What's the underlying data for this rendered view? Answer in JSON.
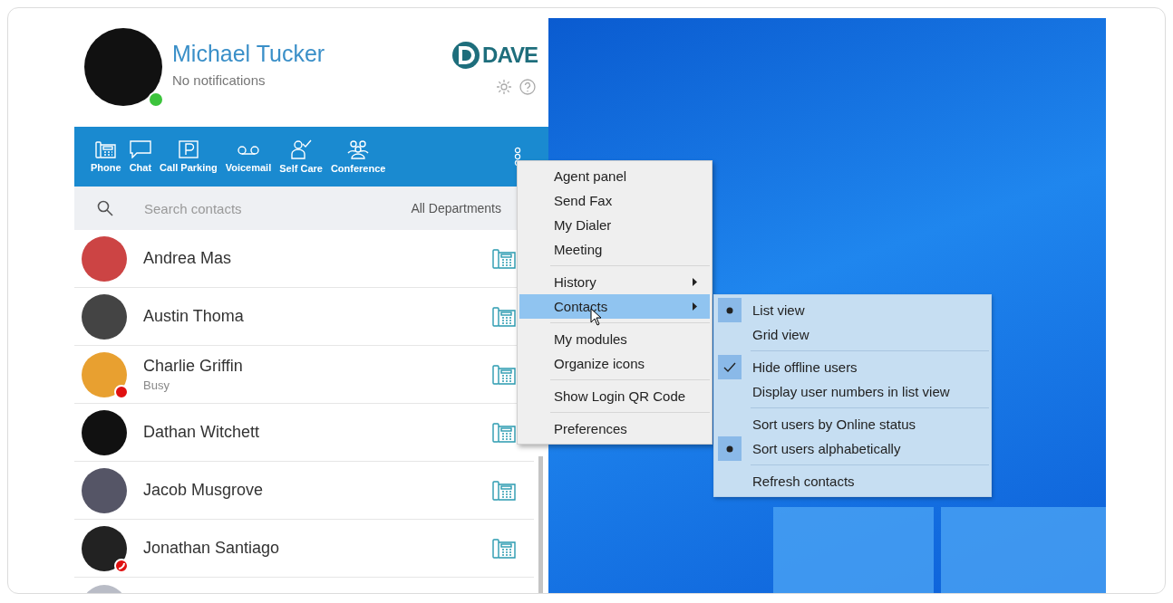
{
  "profile": {
    "name": "Michael Tucker",
    "notifications": "No notifications",
    "status": {
      "color": "#3cc43c",
      "kind": "dot"
    }
  },
  "logo": {
    "text": "DAVE"
  },
  "toolbar": [
    {
      "label": "Phone",
      "kind": "phone"
    },
    {
      "label": "Chat",
      "kind": "chat"
    },
    {
      "label": "Call Parking",
      "kind": "parking"
    },
    {
      "label": "Voicemail",
      "kind": "voicemail"
    },
    {
      "label": "Self Care",
      "kind": "selfcare"
    },
    {
      "label": "Conference",
      "kind": "conference"
    }
  ],
  "search": {
    "placeholder": "Search contacts",
    "department": "All Departments"
  },
  "contacts": [
    {
      "name": "Andrea Mas"
    },
    {
      "name": "Austin Thoma"
    },
    {
      "name": "Charlie Griffin",
      "note": "Busy",
      "status": {
        "color": "#e01010",
        "kind": "dot"
      }
    },
    {
      "name": "Dathan Witchett"
    },
    {
      "name": "Jacob Musgrove"
    },
    {
      "name": "Jonathan Santiago",
      "status": {
        "color": "#e01010",
        "kind": "call"
      }
    }
  ],
  "menu": {
    "groups": [
      [
        {
          "label": "Agent panel",
          "selected": false,
          "submenu": false
        },
        {
          "label": "Send Fax",
          "selected": false,
          "submenu": false
        },
        {
          "label": "My Dialer",
          "selected": false,
          "submenu": false
        },
        {
          "label": "Meeting",
          "selected": false,
          "submenu": false
        }
      ],
      [
        {
          "label": "History",
          "selected": false,
          "submenu": true
        },
        {
          "label": "Contacts",
          "selected": true,
          "submenu": true
        }
      ],
      [
        {
          "label": "My modules",
          "selected": false,
          "submenu": false
        },
        {
          "label": "Organize icons",
          "selected": false,
          "submenu": false
        }
      ],
      [
        {
          "label": "Show Login QR Code",
          "selected": false,
          "submenu": false
        }
      ],
      [
        {
          "label": "Preferences",
          "selected": false,
          "submenu": false
        }
      ]
    ]
  },
  "submenu": {
    "groups": [
      [
        {
          "label": "List view",
          "kind": "radio",
          "checked": true
        },
        {
          "label": "Grid view",
          "kind": "radio",
          "checked": false
        }
      ],
      [
        {
          "label": "Hide offline users",
          "kind": "check",
          "checked": true
        },
        {
          "label": "Display user numbers in list view",
          "kind": "check",
          "checked": false
        }
      ],
      [
        {
          "label": "Sort users by Online status",
          "kind": "radio",
          "checked": false
        },
        {
          "label": "Sort users alphabetically",
          "kind": "radio",
          "checked": true
        }
      ],
      [
        {
          "label": "Refresh contacts",
          "kind": "action"
        }
      ]
    ]
  }
}
